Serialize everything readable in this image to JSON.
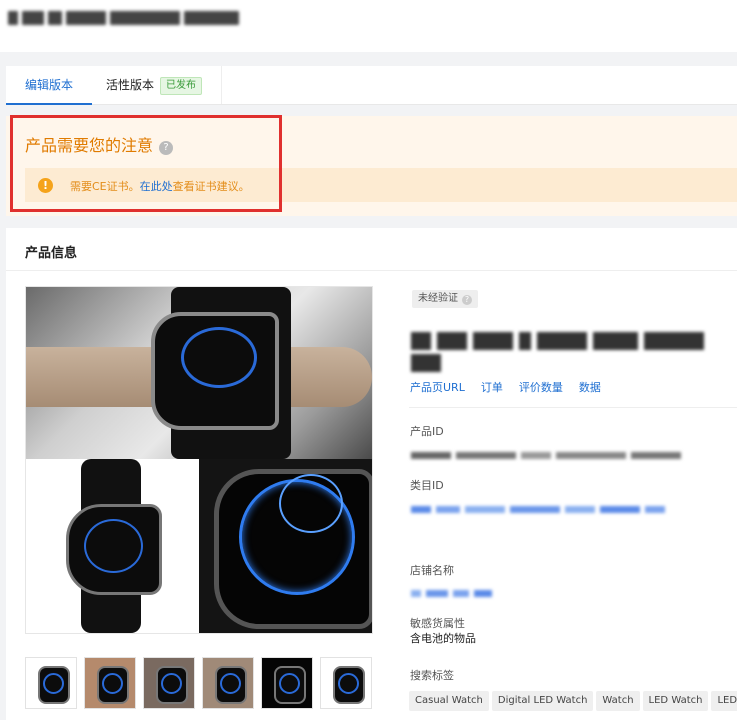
{
  "header": {
    "title": ""
  },
  "tabs": [
    {
      "label": "编辑版本",
      "selected": true
    },
    {
      "label": "活性版本",
      "badge": "已发布"
    }
  ],
  "notice": {
    "title": "产品需要您的注意",
    "message_prefix": "需要CE证书。",
    "message_link": "在此处",
    "message_suffix": "查看证书建议。",
    "accent_color": "#e07b00"
  },
  "product": {
    "section_title": "产品信息",
    "verification": "未经验证",
    "links": [
      "产品页URL",
      "订单",
      "评价数量",
      "数据"
    ],
    "fields": {
      "product_id_label": "产品ID",
      "category_id_label": "类目ID",
      "store_name_label": "店铺名称",
      "sensitive_label": "敏感货属性",
      "sensitive_value": "含电池的物品",
      "tags_label": "搜索标签"
    },
    "tags": [
      "Casual Watch",
      "Digital LED Watch",
      "Watch",
      "LED Watch",
      "LED"
    ]
  }
}
